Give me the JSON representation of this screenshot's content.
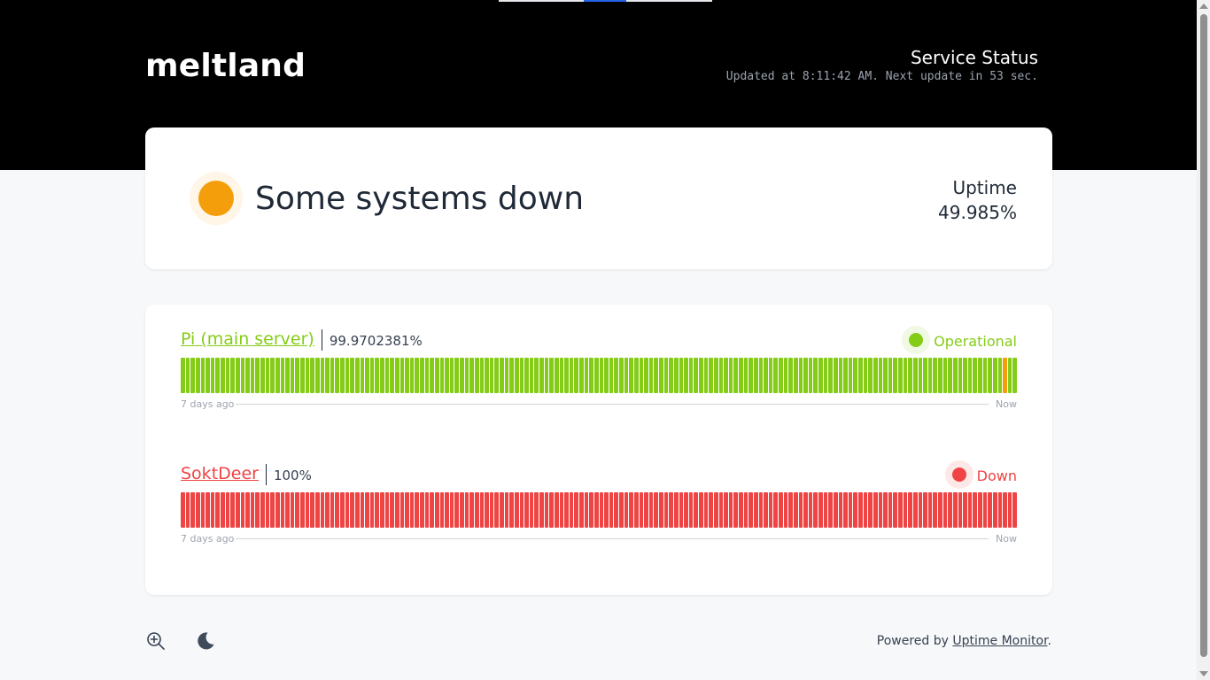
{
  "header": {
    "brand": "meltland",
    "service_title": "Service Status",
    "updated_text": "Updated at 8:11:42 AM. Next update in 53 sec."
  },
  "overall": {
    "status_text": "Some systems down",
    "status_color": "#f59e0b",
    "uptime_label": "Uptime",
    "uptime_value": "49.985%"
  },
  "monitors": [
    {
      "name": "Pi (main server)",
      "uptime": "99.9702381%",
      "status": "Operational",
      "color": "#84cc16",
      "bar_count": 168,
      "incident_bar_indices": [
        165
      ],
      "incident_color": "#f59e0b",
      "range_start": "7 days ago",
      "range_end": "Now"
    },
    {
      "name": "SoktDeer",
      "uptime": "100%",
      "status": "Down",
      "color": "#ef4444",
      "bar_count": 168,
      "incident_bar_indices": [],
      "incident_color": "#ef4444",
      "range_start": "7 days ago",
      "range_end": "Now"
    }
  ],
  "footer": {
    "zoom_icon": "zoom-in-icon",
    "theme_icon": "moon-icon",
    "powered_by": "Powered by",
    "powered_link": "Uptime Monitor",
    "powered_suffix": "."
  }
}
